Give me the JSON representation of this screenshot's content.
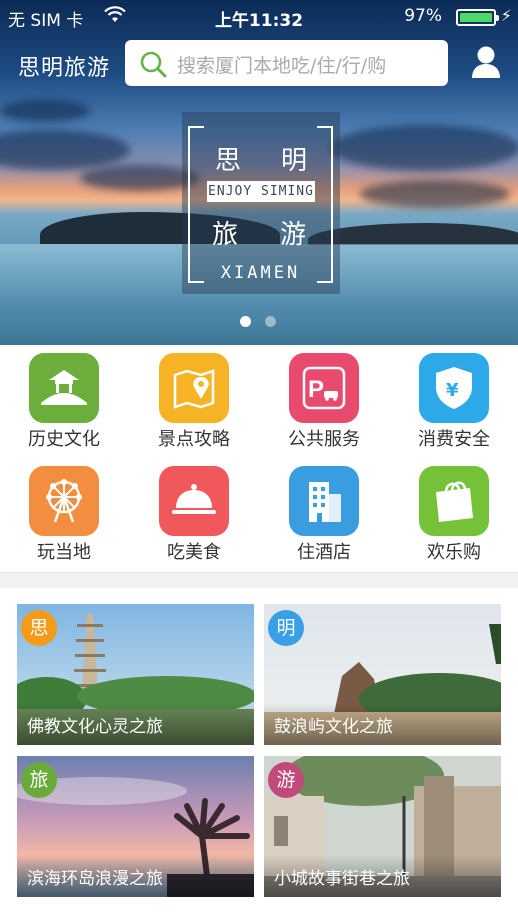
{
  "status_bar": {
    "carrier": "无 SIM 卡",
    "time": "上午11:32",
    "battery": "97%"
  },
  "header": {
    "brand": "思明旅游",
    "search_placeholder": "搜索厦门本地吃/住/行/购"
  },
  "banner": {
    "logo_chars": [
      "思",
      "明",
      "旅",
      "游"
    ],
    "enjoy_text": "ENJOY SIMING",
    "city_text": "XIAMEN",
    "slide_count": 2,
    "active_slide": 1
  },
  "categories": [
    {
      "label": "历史文化",
      "icon": "pavilion-icon",
      "color": "#6cae3c"
    },
    {
      "label": "景点攻略",
      "icon": "map-pin-icon",
      "color": "#f6b326"
    },
    {
      "label": "公共服务",
      "icon": "parking-icon",
      "color": "#e94b6f"
    },
    {
      "label": "消费安全",
      "icon": "yuan-shield-icon",
      "color": "#2da8e8"
    },
    {
      "label": "玩当地",
      "icon": "ferris-wheel-icon",
      "color": "#f38d3f"
    },
    {
      "label": "吃美食",
      "icon": "food-cloche-icon",
      "color": "#f0585b"
    },
    {
      "label": "住酒店",
      "icon": "hotel-icon",
      "color": "#3a9de0"
    },
    {
      "label": "欢乐购",
      "icon": "shopping-bag-icon",
      "color": "#75c138"
    }
  ],
  "routes": [
    {
      "badge": "思",
      "badge_color": "#f59b1a",
      "title": "佛教文化心灵之旅"
    },
    {
      "badge": "明",
      "badge_color": "#3aa0e6",
      "title": "鼓浪屿文化之旅"
    },
    {
      "badge": "旅",
      "badge_color": "#6aaa3a",
      "title": "滨海环岛浪漫之旅"
    },
    {
      "badge": "游",
      "badge_color": "#c24a7a",
      "title": "小城故事街巷之旅"
    }
  ],
  "colors": {
    "battery_fill": "#4cd964",
    "search_icon": "#6ab04c"
  }
}
